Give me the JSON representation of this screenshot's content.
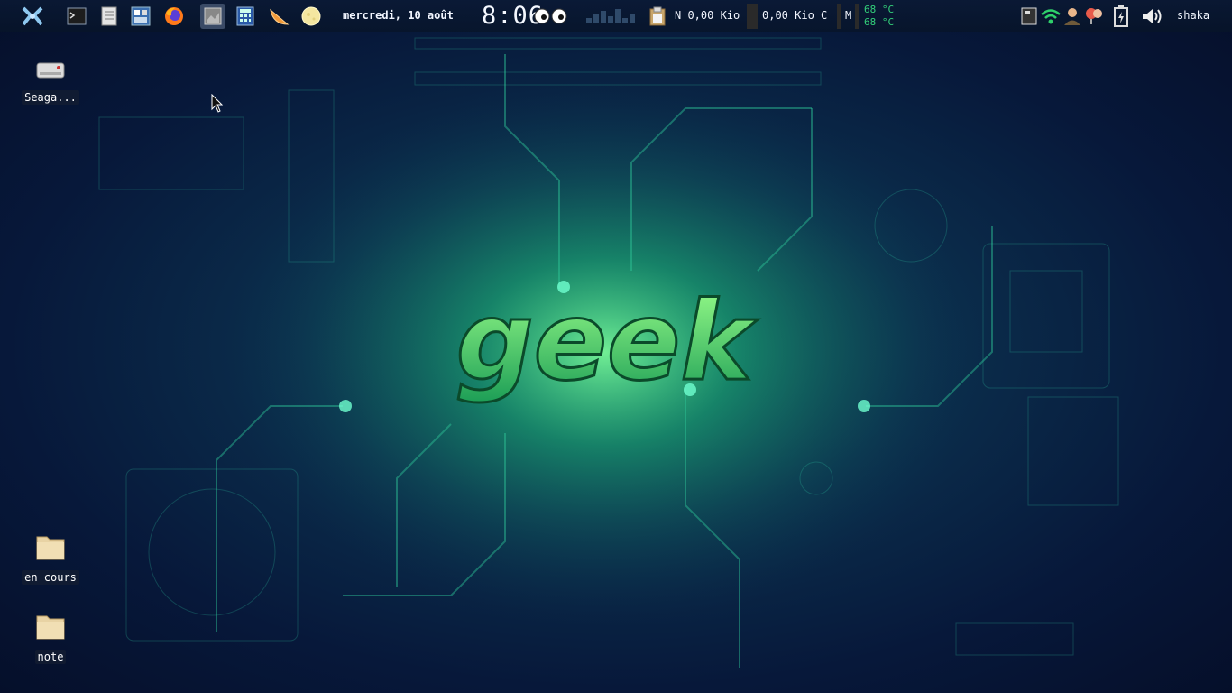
{
  "panel": {
    "launchers": [
      {
        "icon": "xfce-menu-icon"
      },
      {
        "icon": "terminal-icon"
      },
      {
        "icon": "text-editor-icon"
      },
      {
        "icon": "file-manager-icon"
      },
      {
        "icon": "firefox-icon"
      },
      {
        "icon": "image-viewer-icon"
      },
      {
        "icon": "calculator-icon"
      },
      {
        "icon": "orange-slice-icon"
      },
      {
        "icon": "moon-icon"
      }
    ],
    "date": "mercredi, 10 août",
    "clock": "8:06",
    "network_in": "N 0,00 Kio",
    "network_out": "0,00 Kio C",
    "mem_label": "M",
    "temp_1": "68 °C",
    "temp_2": "68 °C",
    "user": "shaka"
  },
  "desktop": {
    "icons": [
      {
        "label": "Seaga...",
        "icon": "drive-icon"
      },
      {
        "label": "en cours",
        "icon": "folder-icon"
      },
      {
        "label": "note",
        "icon": "folder-icon"
      }
    ]
  },
  "wallpaper": {
    "logo_text": "geek"
  },
  "colors": {
    "accent": "#33d07a",
    "panel_bg": "#0b1a35"
  }
}
